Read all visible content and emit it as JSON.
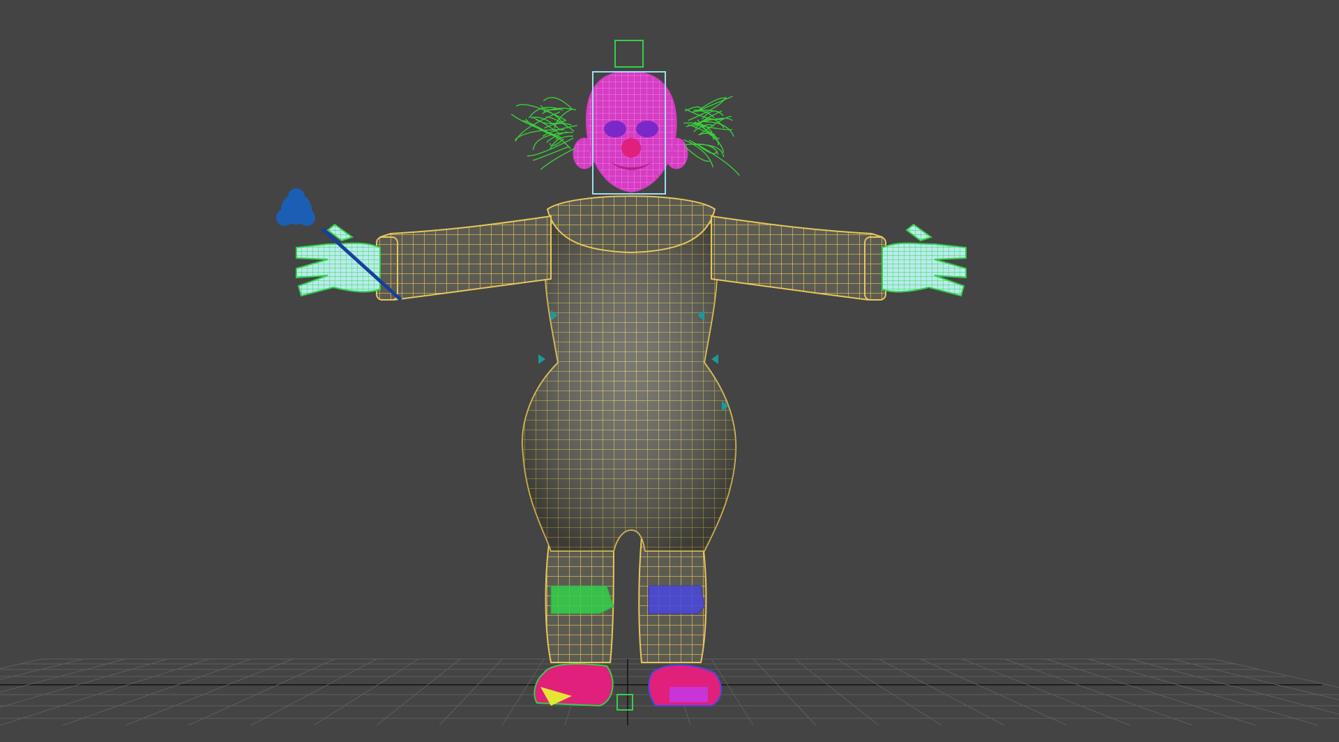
{
  "viewport": {
    "kind": "3d-perspective-viewport",
    "background_color": "#444444",
    "grid_color": "#5e5e5e",
    "grid_axis_color": "#111111"
  },
  "scene": {
    "model": "clown-character-wireframe",
    "colors": {
      "mesh_wire": "#e8c75a",
      "mesh_fill": "#6b6b60",
      "head": "#d63cc4",
      "hair": "#39d13a",
      "hand": "#a8e8e8",
      "hand_wire": "#33d14a",
      "flower": "#1a5fb4",
      "stem": "#1a3d9e",
      "cuff_left": "#33d14a",
      "cuff_right": "#4848e0",
      "shoe": "#e0207a",
      "shoe_right": "#c834d8",
      "shoe_accent": "#e6e632",
      "selection_box": "#9ee0f0",
      "helper_square": "#33d14a",
      "bone_teal": "#1a9a9a"
    }
  }
}
